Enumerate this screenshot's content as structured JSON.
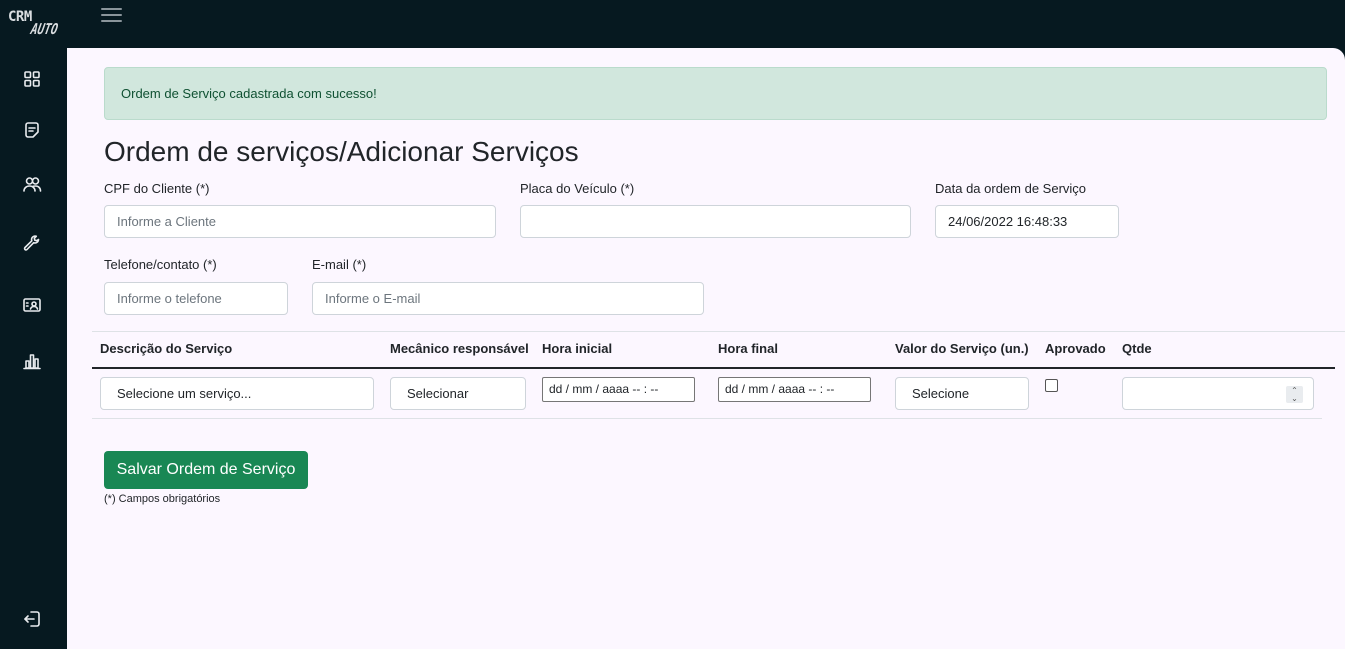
{
  "app": {
    "logo_top": "CRM",
    "logo_bottom": "AUTO"
  },
  "sidebar": {
    "items": [
      {
        "icon": "grid-icon"
      },
      {
        "icon": "note-icon"
      },
      {
        "icon": "users-icon"
      },
      {
        "icon": "wrench-icon"
      },
      {
        "icon": "id-card-icon"
      },
      {
        "icon": "bar-chart-icon"
      },
      {
        "icon": "logout-icon"
      }
    ]
  },
  "alert": {
    "message": "Ordem de Serviço cadastrada com sucesso!"
  },
  "page": {
    "title": "Ordem de serviços/Adicionar Serviços"
  },
  "form": {
    "cpf": {
      "label": "CPF do Cliente (*)",
      "placeholder": "Informe a Cliente",
      "value": ""
    },
    "placa": {
      "label": "Placa do Veículo (*)",
      "value": ""
    },
    "data": {
      "label": "Data da ordem de Serviço",
      "value": "24/06/2022 16:48:33"
    },
    "telefone": {
      "label": "Telefone/contato (*)",
      "placeholder": "Informe o telefone"
    },
    "email": {
      "label": "E-mail (*)",
      "placeholder": "Informe o E-mail"
    }
  },
  "table": {
    "headers": [
      "Descrição do Serviço",
      "Mecânico responsável",
      "Hora inicial",
      "Hora final",
      "Valor do Serviço (un.)",
      "Aprovado",
      "Qtde"
    ],
    "row": {
      "servico": "Selecione um serviço...",
      "mecanico": "Selecionar",
      "hora_inicial": "dd / mm / aaaa   -- : --",
      "hora_final": "dd / mm / aaaa   -- : --",
      "valor": "Selecione",
      "aprovado": false,
      "qtde": ""
    }
  },
  "actions": {
    "save_label": "Salvar Ordem de Serviço"
  },
  "footer_note": "(*) Campos obrigatórios",
  "colors": {
    "sidebar_bg": "#061920",
    "alert_bg": "#d1e7dd",
    "alert_text": "#0f5132",
    "primary_button": "#198754",
    "main_bg": "#fcf7ff"
  }
}
